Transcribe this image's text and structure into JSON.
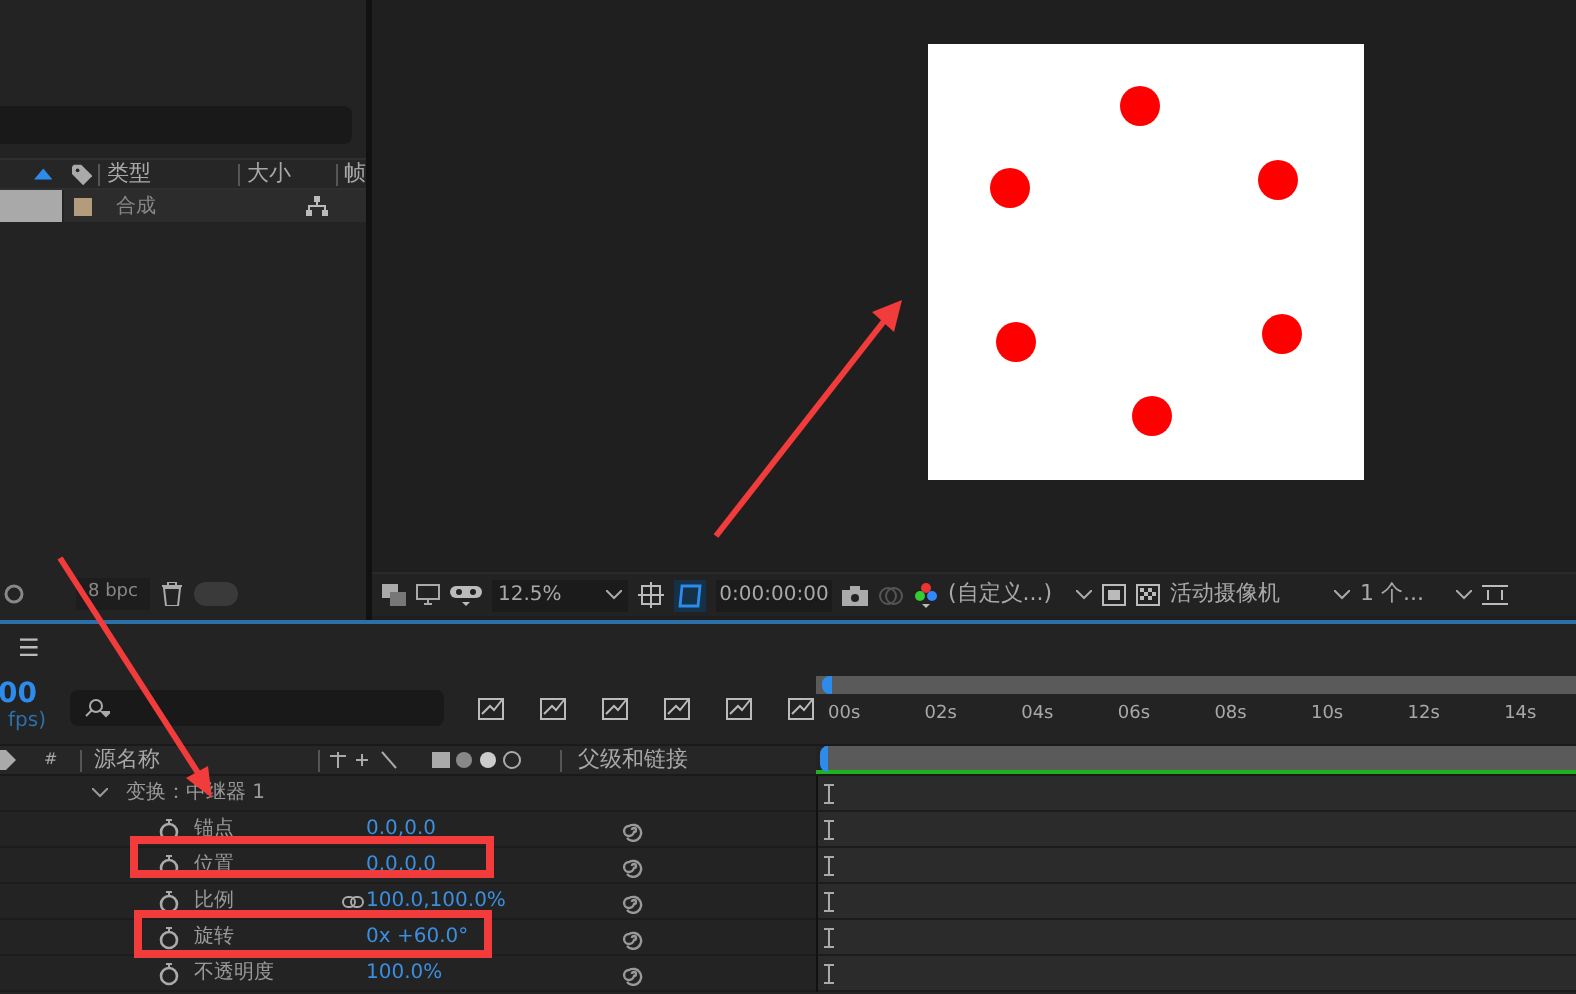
{
  "project_panel": {
    "columns": [
      "类型",
      "大小",
      "帧"
    ],
    "items": [
      {
        "type": "合成",
        "selected": true,
        "color": "#b39c7c"
      }
    ],
    "bit_depth": "8 bpc",
    "toggle": {
      "on": false
    }
  },
  "viewer": {
    "zoom": "12.5%",
    "timecode": "0:00:00:00",
    "resolution": "(自定义...)",
    "camera": "活动摄像机",
    "views": "1 个..."
  },
  "timeline": {
    "menu": "☰",
    "timecode": "00",
    "fps": "fps)",
    "columns": [
      "#",
      "源名称",
      "父级和链接"
    ],
    "ruler": [
      "00s",
      "02s",
      "04s",
      "06s",
      "08s",
      "10s",
      "12s",
      "14s"
    ],
    "group": {
      "name": "变换：中继器 1",
      "expanded": true
    },
    "properties": [
      {
        "name": "锚点",
        "value": "0.0,0.0",
        "linked": false
      },
      {
        "name": "位置",
        "value": "0.0,0.0",
        "linked": false
      },
      {
        "name": "比例",
        "value": "100.0,100.0%",
        "linked": true
      },
      {
        "name": "旋转",
        "value": "0x +60.0°",
        "linked": false
      },
      {
        "name": "不透明度",
        "value": "100.0%",
        "linked": false
      }
    ]
  }
}
